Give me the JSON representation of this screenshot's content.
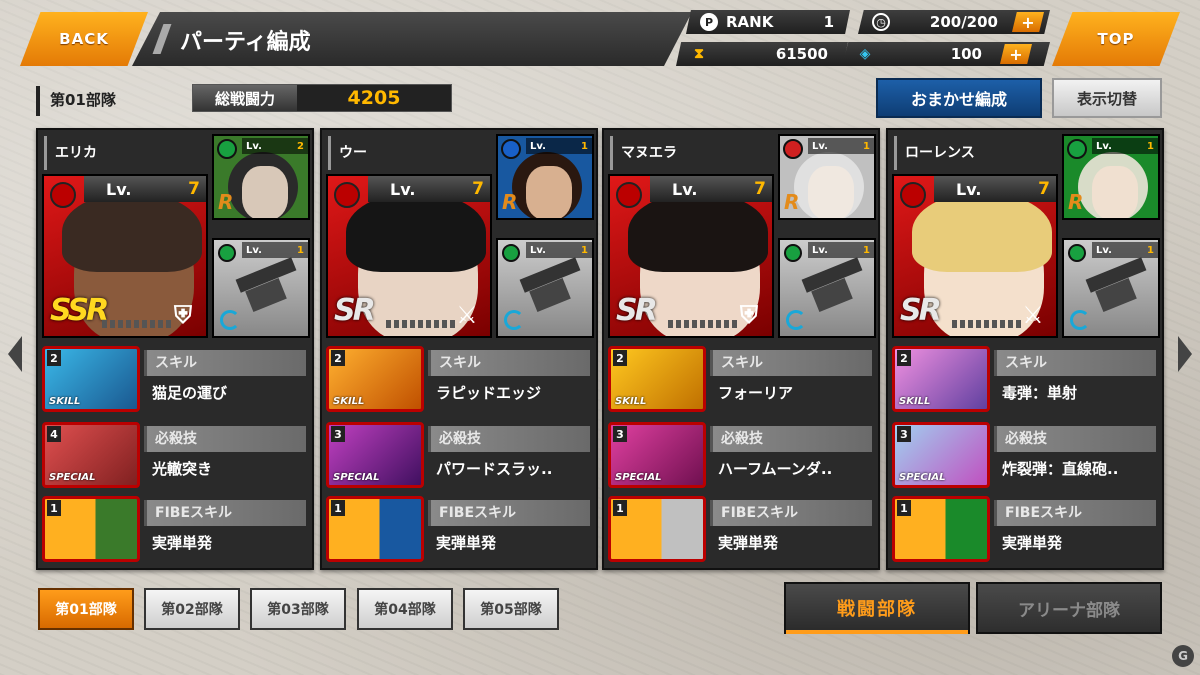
{
  "header": {
    "back_label": "BACK",
    "title": "パーティ編成",
    "top_label": "TOP",
    "rank_label": "RANK",
    "rank_value": "1",
    "stamina": "200/200",
    "currency": "61500",
    "gems": "100",
    "plus": "+"
  },
  "team": {
    "label": "第01部隊",
    "power_label": "総戦闘力",
    "power_value": "4205",
    "auto_button": "おまかせ編成",
    "view_button": "表示切替"
  },
  "cards": [
    {
      "name": "エリカ",
      "lv_label": "Lv.",
      "lv": "7",
      "rarity": "SSR",
      "role": "shield",
      "sub_lv": "2",
      "sub_rarity": "R",
      "weapon_lv": "1",
      "skill_label": "スキル",
      "skill": "猫足の運び",
      "skill_count": "2",
      "special_label": "必殺技",
      "special": "光轍突き",
      "special_count": "4",
      "fibe_label": "FIBEスキル",
      "fibe": "実弾単発",
      "fibe_count": "1"
    },
    {
      "name": "ウー",
      "lv_label": "Lv.",
      "lv": "7",
      "rarity": "SR",
      "role": "sword",
      "sub_lv": "1",
      "sub_rarity": "R",
      "weapon_lv": "1",
      "skill_label": "スキル",
      "skill": "ラピッドエッジ",
      "skill_count": "2",
      "special_label": "必殺技",
      "special": "パワードスラッ..",
      "special_count": "3",
      "fibe_label": "FIBEスキル",
      "fibe": "実弾単発",
      "fibe_count": "1"
    },
    {
      "name": "マヌエラ",
      "lv_label": "Lv.",
      "lv": "7",
      "rarity": "SR",
      "role": "shield",
      "sub_lv": "1",
      "sub_rarity": "R",
      "weapon_lv": "1",
      "skill_label": "スキル",
      "skill": "フォーリア",
      "skill_count": "2",
      "special_label": "必殺技",
      "special": "ハーフムーンダ..",
      "special_count": "3",
      "fibe_label": "FIBEスキル",
      "fibe": "実弾単発",
      "fibe_count": "1"
    },
    {
      "name": "ローレンス",
      "lv_label": "Lv.",
      "lv": "7",
      "rarity": "SR",
      "role": "sword",
      "sub_lv": "1",
      "sub_rarity": "R",
      "weapon_lv": "1",
      "skill_label": "スキル",
      "skill": "毒弾：単射",
      "skill_count": "2",
      "special_label": "必殺技",
      "special": "炸裂弾：直線砲..",
      "special_count": "3",
      "fibe_label": "FIBEスキル",
      "fibe": "実弾単発",
      "fibe_count": "1"
    }
  ],
  "skill_tags": {
    "skill": "SKILL",
    "special": "SPECIAL"
  },
  "tabs": [
    "第01部隊",
    "第02部隊",
    "第03部隊",
    "第04部隊",
    "第05部隊"
  ],
  "modes": {
    "battle": "戦闘部隊",
    "arena": "アリーナ部隊"
  },
  "watermark": "G",
  "colors": {
    "accent": "#ff9c1a",
    "power": "#ffb800",
    "auto": "#1d5fa8"
  }
}
